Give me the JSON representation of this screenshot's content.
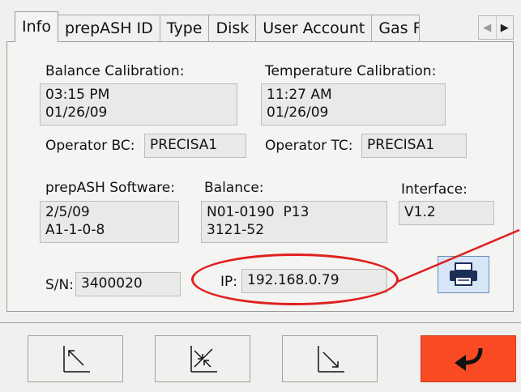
{
  "tabs": [
    {
      "label": "Info",
      "active": true
    },
    {
      "label": "prepASH ID"
    },
    {
      "label": "Type"
    },
    {
      "label": "Disk"
    },
    {
      "label": "User Account"
    },
    {
      "label": "Gas F"
    }
  ],
  "tab_scroll": {
    "left_icon": "triangle-left-icon",
    "right_icon": "triangle-right-icon"
  },
  "balance_calibration": {
    "label": "Balance Calibration:",
    "value": "03:15 PM\n01/26/09"
  },
  "temperature_calibration": {
    "label": "Temperature Calibration:",
    "value": "11:27 AM\n01/26/09"
  },
  "operator_bc": {
    "label": "Operator BC:",
    "value": "PRECISA1"
  },
  "operator_tc": {
    "label": "Operator TC:",
    "value": "PRECISA1"
  },
  "software": {
    "label": "prepASH Software:",
    "value": "2/5/09\nA1-1-0-8"
  },
  "balance": {
    "label": "Balance:",
    "value": "N01-0190  P13\n3121-52"
  },
  "interface": {
    "label": "Interface:",
    "value": "V1.2"
  },
  "serial": {
    "label": "S/N:",
    "value": "3400020"
  },
  "ip": {
    "label": "IP:",
    "value": "192.168.0.79"
  },
  "print_button": {
    "icon": "printer-icon"
  },
  "nav_buttons": [
    {
      "icon": "arrow-up-left-icon"
    },
    {
      "icon": "arrows-converge-icon"
    },
    {
      "icon": "arrow-down-right-icon"
    }
  ],
  "enter_button": {
    "icon": "enter-return-icon"
  },
  "colors": {
    "annotation": "#e02020",
    "enter_button": "#fa4a24",
    "print_button": "#d7e6f7"
  }
}
